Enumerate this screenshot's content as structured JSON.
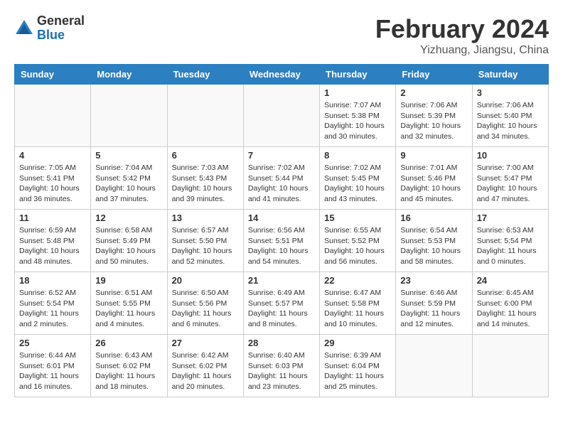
{
  "header": {
    "logo_general": "General",
    "logo_blue": "Blue",
    "month_year": "February 2024",
    "location": "Yizhuang, Jiangsu, China"
  },
  "weekdays": [
    "Sunday",
    "Monday",
    "Tuesday",
    "Wednesday",
    "Thursday",
    "Friday",
    "Saturday"
  ],
  "weeks": [
    [
      {
        "day": "",
        "detail": ""
      },
      {
        "day": "",
        "detail": ""
      },
      {
        "day": "",
        "detail": ""
      },
      {
        "day": "",
        "detail": ""
      },
      {
        "day": "1",
        "detail": "Sunrise: 7:07 AM\nSunset: 5:38 PM\nDaylight: 10 hours\nand 30 minutes."
      },
      {
        "day": "2",
        "detail": "Sunrise: 7:06 AM\nSunset: 5:39 PM\nDaylight: 10 hours\nand 32 minutes."
      },
      {
        "day": "3",
        "detail": "Sunrise: 7:06 AM\nSunset: 5:40 PM\nDaylight: 10 hours\nand 34 minutes."
      }
    ],
    [
      {
        "day": "4",
        "detail": "Sunrise: 7:05 AM\nSunset: 5:41 PM\nDaylight: 10 hours\nand 36 minutes."
      },
      {
        "day": "5",
        "detail": "Sunrise: 7:04 AM\nSunset: 5:42 PM\nDaylight: 10 hours\nand 37 minutes."
      },
      {
        "day": "6",
        "detail": "Sunrise: 7:03 AM\nSunset: 5:43 PM\nDaylight: 10 hours\nand 39 minutes."
      },
      {
        "day": "7",
        "detail": "Sunrise: 7:02 AM\nSunset: 5:44 PM\nDaylight: 10 hours\nand 41 minutes."
      },
      {
        "day": "8",
        "detail": "Sunrise: 7:02 AM\nSunset: 5:45 PM\nDaylight: 10 hours\nand 43 minutes."
      },
      {
        "day": "9",
        "detail": "Sunrise: 7:01 AM\nSunset: 5:46 PM\nDaylight: 10 hours\nand 45 minutes."
      },
      {
        "day": "10",
        "detail": "Sunrise: 7:00 AM\nSunset: 5:47 PM\nDaylight: 10 hours\nand 47 minutes."
      }
    ],
    [
      {
        "day": "11",
        "detail": "Sunrise: 6:59 AM\nSunset: 5:48 PM\nDaylight: 10 hours\nand 48 minutes."
      },
      {
        "day": "12",
        "detail": "Sunrise: 6:58 AM\nSunset: 5:49 PM\nDaylight: 10 hours\nand 50 minutes."
      },
      {
        "day": "13",
        "detail": "Sunrise: 6:57 AM\nSunset: 5:50 PM\nDaylight: 10 hours\nand 52 minutes."
      },
      {
        "day": "14",
        "detail": "Sunrise: 6:56 AM\nSunset: 5:51 PM\nDaylight: 10 hours\nand 54 minutes."
      },
      {
        "day": "15",
        "detail": "Sunrise: 6:55 AM\nSunset: 5:52 PM\nDaylight: 10 hours\nand 56 minutes."
      },
      {
        "day": "16",
        "detail": "Sunrise: 6:54 AM\nSunset: 5:53 PM\nDaylight: 10 hours\nand 58 minutes."
      },
      {
        "day": "17",
        "detail": "Sunrise: 6:53 AM\nSunset: 5:54 PM\nDaylight: 11 hours\nand 0 minutes."
      }
    ],
    [
      {
        "day": "18",
        "detail": "Sunrise: 6:52 AM\nSunset: 5:54 PM\nDaylight: 11 hours\nand 2 minutes."
      },
      {
        "day": "19",
        "detail": "Sunrise: 6:51 AM\nSunset: 5:55 PM\nDaylight: 11 hours\nand 4 minutes."
      },
      {
        "day": "20",
        "detail": "Sunrise: 6:50 AM\nSunset: 5:56 PM\nDaylight: 11 hours\nand 6 minutes."
      },
      {
        "day": "21",
        "detail": "Sunrise: 6:49 AM\nSunset: 5:57 PM\nDaylight: 11 hours\nand 8 minutes."
      },
      {
        "day": "22",
        "detail": "Sunrise: 6:47 AM\nSunset: 5:58 PM\nDaylight: 11 hours\nand 10 minutes."
      },
      {
        "day": "23",
        "detail": "Sunrise: 6:46 AM\nSunset: 5:59 PM\nDaylight: 11 hours\nand 12 minutes."
      },
      {
        "day": "24",
        "detail": "Sunrise: 6:45 AM\nSunset: 6:00 PM\nDaylight: 11 hours\nand 14 minutes."
      }
    ],
    [
      {
        "day": "25",
        "detail": "Sunrise: 6:44 AM\nSunset: 6:01 PM\nDaylight: 11 hours\nand 16 minutes."
      },
      {
        "day": "26",
        "detail": "Sunrise: 6:43 AM\nSunset: 6:02 PM\nDaylight: 11 hours\nand 18 minutes."
      },
      {
        "day": "27",
        "detail": "Sunrise: 6:42 AM\nSunset: 6:02 PM\nDaylight: 11 hours\nand 20 minutes."
      },
      {
        "day": "28",
        "detail": "Sunrise: 6:40 AM\nSunset: 6:03 PM\nDaylight: 11 hours\nand 23 minutes."
      },
      {
        "day": "29",
        "detail": "Sunrise: 6:39 AM\nSunset: 6:04 PM\nDaylight: 11 hours\nand 25 minutes."
      },
      {
        "day": "",
        "detail": ""
      },
      {
        "day": "",
        "detail": ""
      }
    ]
  ]
}
